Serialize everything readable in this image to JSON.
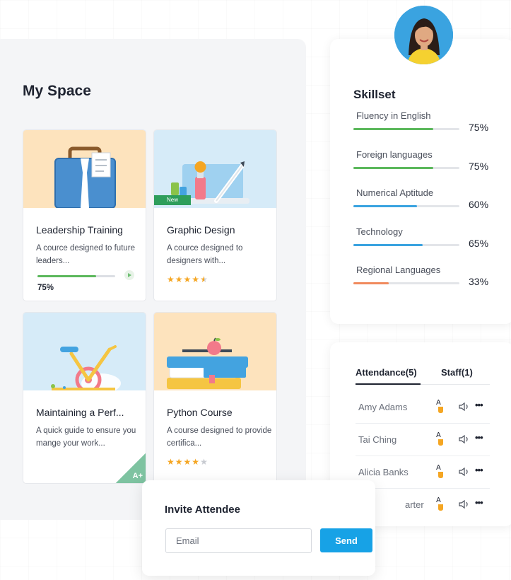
{
  "my_space": {
    "title": "My Space",
    "courses": [
      {
        "title": "Leadership Training",
        "description": "A cource designed to future leaders...",
        "progress_label": "75%",
        "progress": 0.75
      },
      {
        "title": "Graphic Design",
        "description": "A cource designed to designers with...",
        "rating": 4.5,
        "badge": "New"
      },
      {
        "title": "Maintaining a Perf...",
        "description": "A quick guide to ensure you mange your work...",
        "grade": "A+"
      },
      {
        "title": "Python Course",
        "description": "A course designed to provide certifica...",
        "rating": 4
      }
    ]
  },
  "skillset": {
    "title": "Skillset",
    "skills": [
      {
        "name": "Fluency in English",
        "percent_label": "75%",
        "value": 0.75,
        "color": "#5cb85c"
      },
      {
        "name": "Foreign languages",
        "percent_label": "75%",
        "value": 0.75,
        "color": "#5cb85c"
      },
      {
        "name": "Numerical Aptitude",
        "percent_label": "60%",
        "value": 0.6,
        "color": "#3aa3e0"
      },
      {
        "name": "Technology",
        "percent_label": "65%",
        "value": 0.65,
        "color": "#3aa3e0"
      },
      {
        "name": "Regional Languages",
        "percent_label": "33%",
        "value": 0.33,
        "color": "#f08a5d"
      }
    ]
  },
  "attendance": {
    "tabs": [
      "Attendance(5)",
      "Staff(1)"
    ],
    "attendees": [
      {
        "name": "Amy Adams"
      },
      {
        "name": "Tai Ching"
      },
      {
        "name": "Alicia Banks"
      },
      {
        "name": "arter"
      }
    ],
    "icons": [
      "raise-hand-icon",
      "speaker-icon",
      "more-icon"
    ],
    "more_label": "•••"
  },
  "invite": {
    "title": "Invite Attendee",
    "email_placeholder": "Email",
    "send_label": "Send"
  },
  "colors": {
    "accent": "#17a2e6",
    "progress_green": "#5cb85c",
    "star": "#f5a623"
  }
}
